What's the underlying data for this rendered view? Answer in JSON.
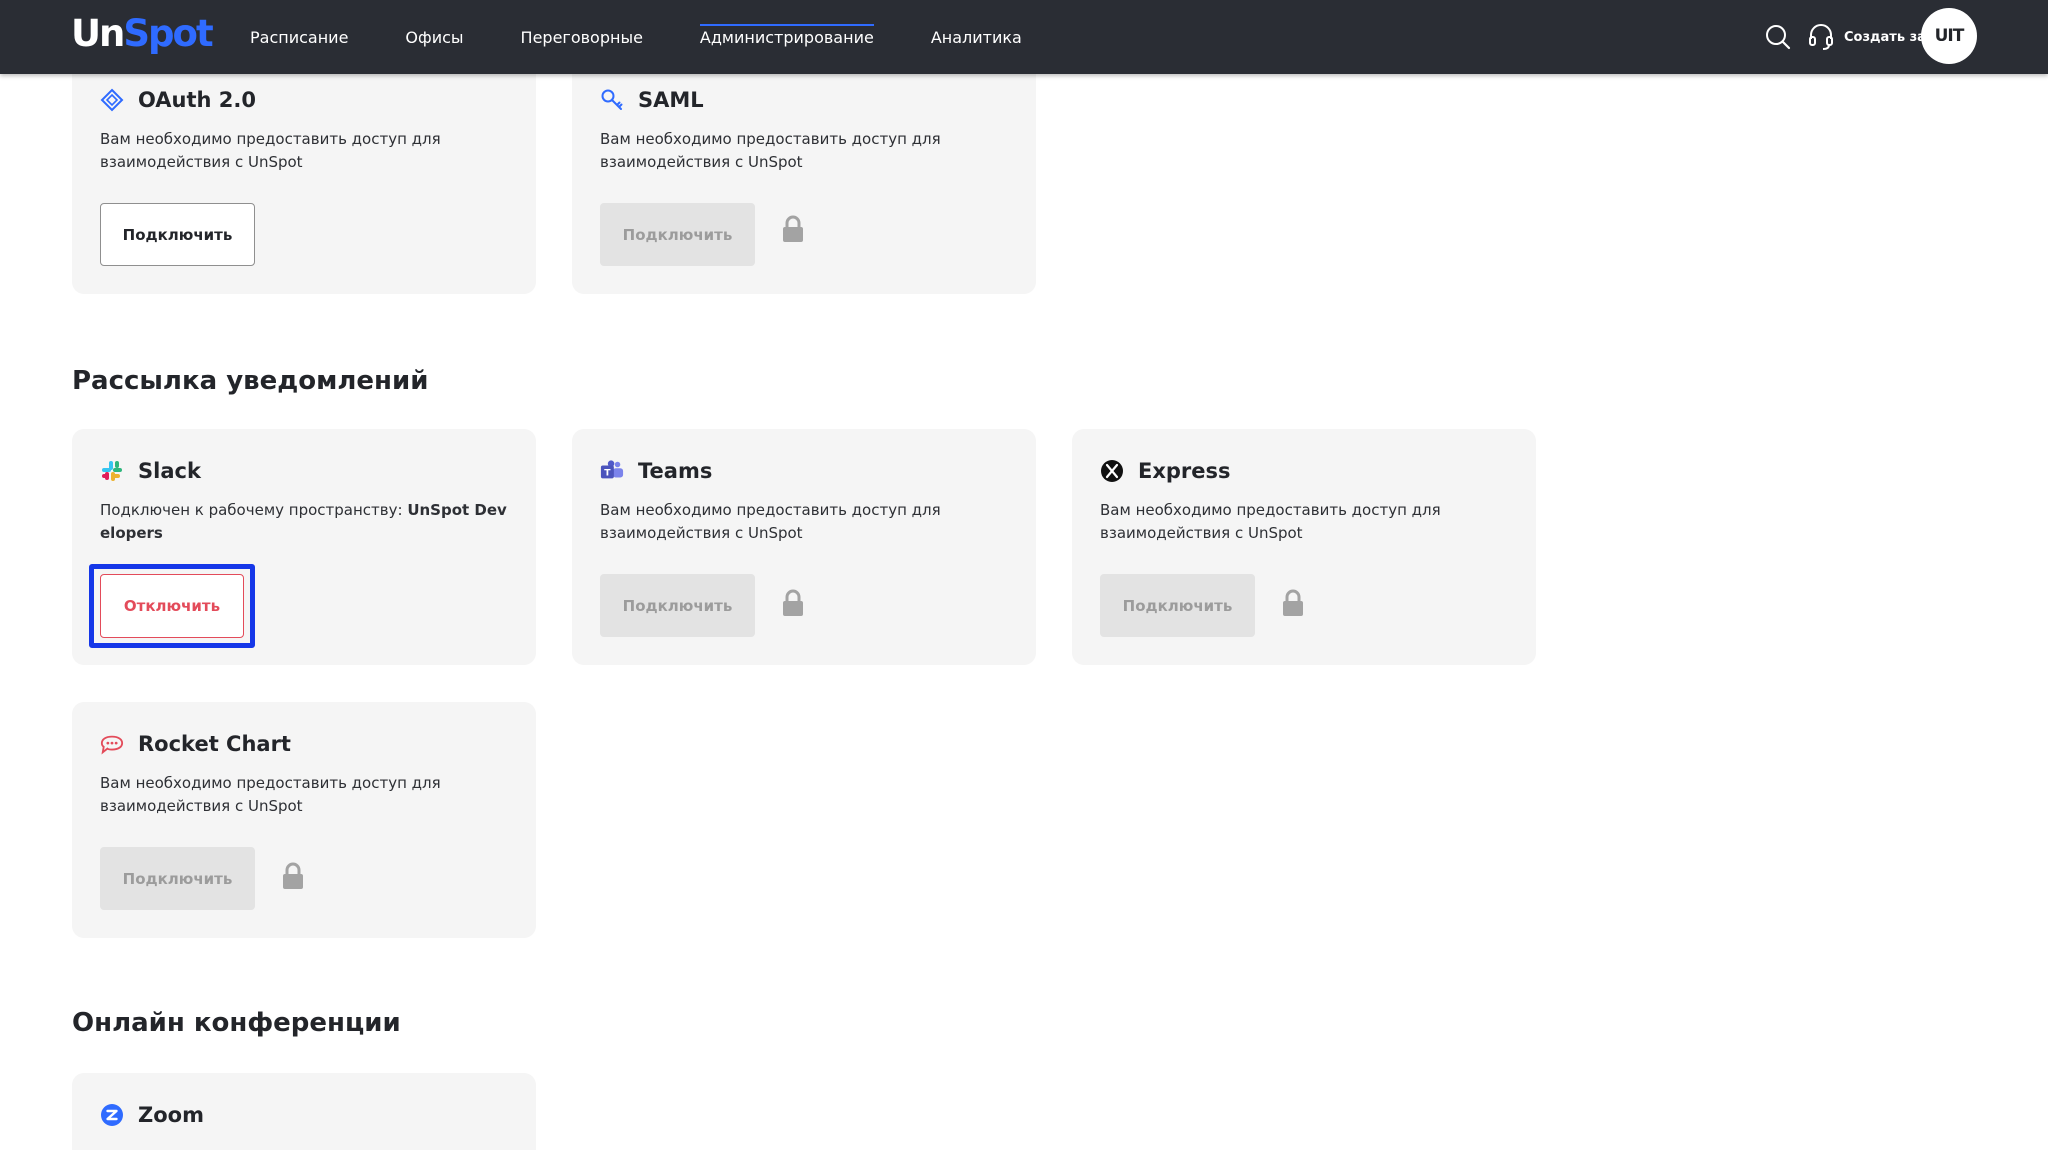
{
  "app": {
    "logo_un": "Un",
    "logo_spot": "Spot"
  },
  "nav": {
    "items": [
      {
        "label": "Расписание",
        "active": false
      },
      {
        "label": "Офисы",
        "active": false
      },
      {
        "label": "Переговорные",
        "active": false
      },
      {
        "label": "Администрирование",
        "active": true
      },
      {
        "label": "Аналитика",
        "active": false
      }
    ],
    "support_label": "Создать заявку",
    "avatar_initials": "UIT"
  },
  "colors": {
    "topbar": "#2a2d34",
    "accent": "#2f6bff",
    "danger": "#e34b5a",
    "focus": "#1537e8",
    "card_bg": "#f5f5f5"
  },
  "sections": {
    "notifications_title": "Рассылка уведомлений",
    "conferences_title": "Онлайн конференции"
  },
  "cards": {
    "oauth": {
      "title": "OAuth 2.0",
      "icon": "oauth-diamond-icon",
      "desc": "Вам необходимо предоставить доступ для взаимодействия с UnSpot",
      "button": "Подключить"
    },
    "saml": {
      "title": "SAML",
      "icon": "saml-key-icon",
      "desc": "Вам необходимо предоставить доступ для взаимодействия с UnSpot",
      "button": "Подключить"
    },
    "slack": {
      "title": "Slack",
      "icon": "slack-logo-icon",
      "desc_prefix": "Подключен к рабочему пространству: ",
      "workspace": "UnSpot Developers",
      "button": "Отключить"
    },
    "teams": {
      "title": "Teams",
      "icon": "teams-logo-icon",
      "desc": "Вам необходимо предоставить доступ для взаимодействия с UnSpot",
      "button": "Подключить"
    },
    "express": {
      "title": "Express",
      "icon": "express-logo-icon",
      "desc": "Вам необходимо предоставить доступ для взаимодействия с UnSpot",
      "button": "Подключить"
    },
    "rocket": {
      "title": "Rocket Chart",
      "icon": "rocket-chat-icon",
      "desc": "Вам необходимо предоставить доступ для взаимодействия с UnSpot",
      "button": "Подключить"
    },
    "zoom": {
      "title": "Zoom",
      "icon": "zoom-logo-icon"
    }
  }
}
